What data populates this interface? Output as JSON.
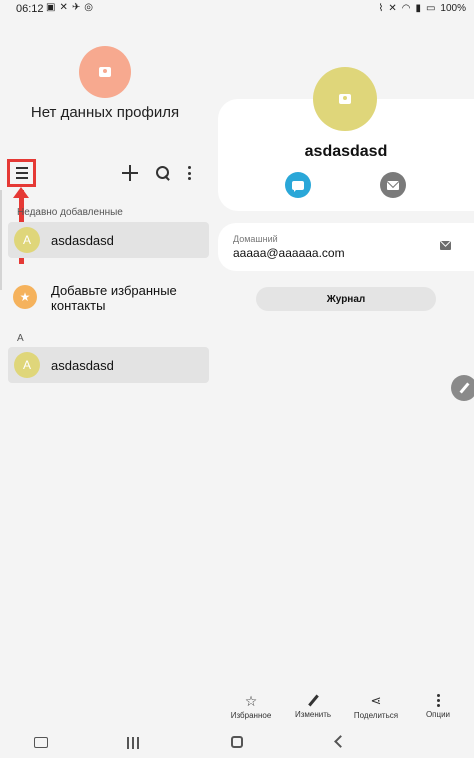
{
  "status_bar": {
    "time": "06:12",
    "battery": "100%",
    "left_icons": [
      "image-icon",
      "mute-icon",
      "airplane-icon",
      "sync-icon"
    ],
    "right_icons": [
      "nfc-icon",
      "mute-icon",
      "wifi-icon",
      "signal-icon",
      "battery-icon"
    ]
  },
  "profile": {
    "name": "Нет данных профиля",
    "avatar_color": "#f7a98f"
  },
  "toolbar": {
    "menu_icon": "hamburger-menu-icon",
    "add_icon": "plus-icon",
    "search_icon": "search-icon",
    "more_icon": "more-vertical-icon",
    "highlight_color": "#e53935"
  },
  "list": {
    "recent_header": "Недавно добавленные",
    "recent_items": [
      {
        "initial": "A",
        "name": "asdasdasd"
      }
    ],
    "favorites_prompt": "Добавьте избранные контакты",
    "favorites_icon": "star-icon",
    "group_header": "A",
    "group_items": [
      {
        "initial": "A",
        "name": "asdasdasd"
      }
    ]
  },
  "contact": {
    "name": "asdasdasd",
    "avatar_color": "#dfd67a",
    "message_color": "#2aa7d8",
    "email_type": "Домашний",
    "email": "aaaaa@aaaaaa.com",
    "journal_label": "Журнал"
  },
  "actions": {
    "favorite": "Избранное",
    "edit": "Изменить",
    "share": "Поделиться",
    "options": "Опции"
  }
}
